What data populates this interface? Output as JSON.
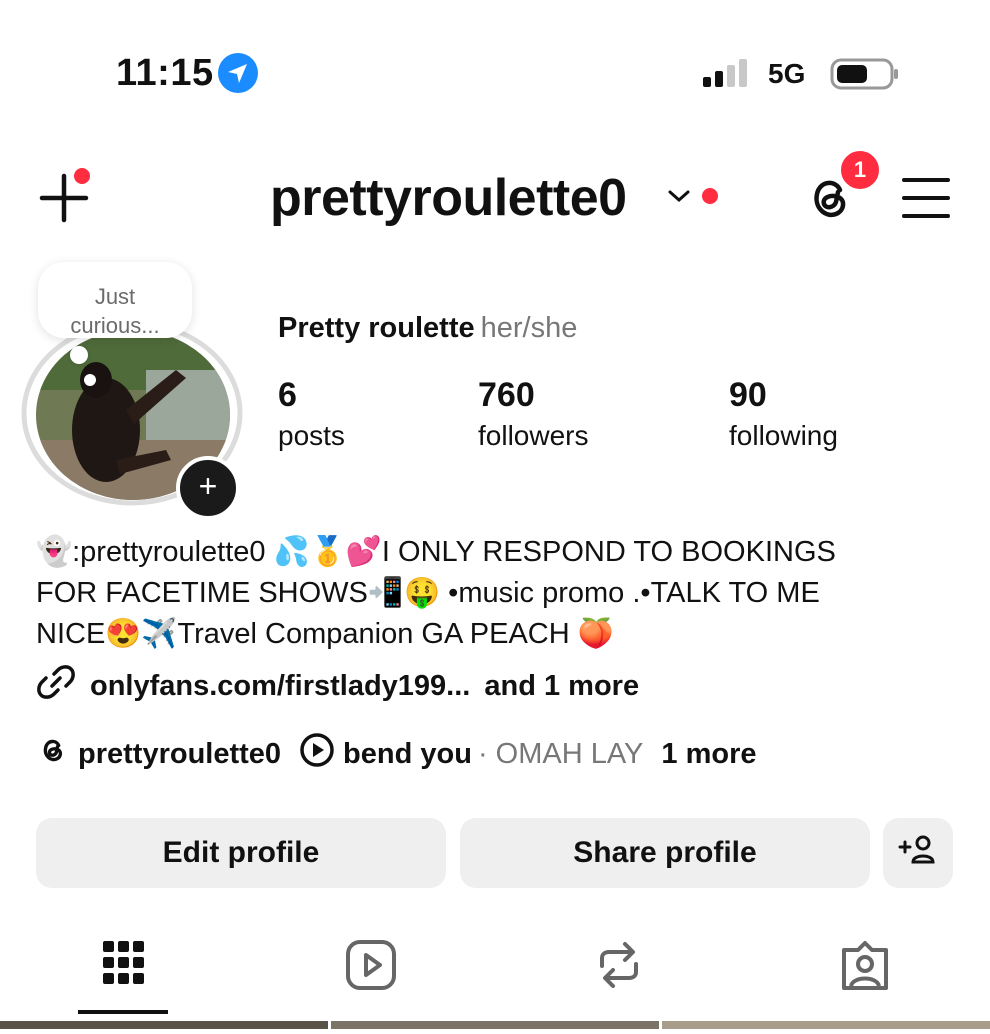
{
  "status_bar": {
    "time": "11:15",
    "network": "5G"
  },
  "header": {
    "username": "prettyroulette0",
    "threads_badge": "1"
  },
  "profile": {
    "note": "Just\ncurious...",
    "display_name": "Pretty roulette",
    "pronouns": "her/she",
    "stats": [
      {
        "value": "6",
        "label": "posts"
      },
      {
        "value": "760",
        "label": "followers"
      },
      {
        "value": "90",
        "label": "following"
      }
    ],
    "bio": "👻:prettyroulette0 💦🥇💕I ONLY RESPOND TO BOOKINGS\nFOR FACETIME SHOWS📲🤑 •music promo .•TALK TO ME\nNICE😍✈️Travel Companion GA PEACH 🍑",
    "link_text": "onlyfans.com/firstlady199...",
    "link_more": "and 1 more",
    "threads_handle": "prettyroulette0",
    "music": {
      "title": "bend you",
      "separator": "·",
      "artist": "OMAH LAY",
      "more": "1 more"
    }
  },
  "buttons": {
    "edit": "Edit profile",
    "share": "Share profile"
  },
  "tabs": [
    {
      "icon": "grid-icon",
      "active": true
    },
    {
      "icon": "reels-icon",
      "active": false
    },
    {
      "icon": "reposts-icon",
      "active": false
    },
    {
      "icon": "tagged-icon",
      "active": false
    }
  ],
  "colors": {
    "accent_red": "#ff2d3f",
    "location_blue": "#1a8cff",
    "button_bg": "#efeff0",
    "muted_text": "#777777"
  }
}
